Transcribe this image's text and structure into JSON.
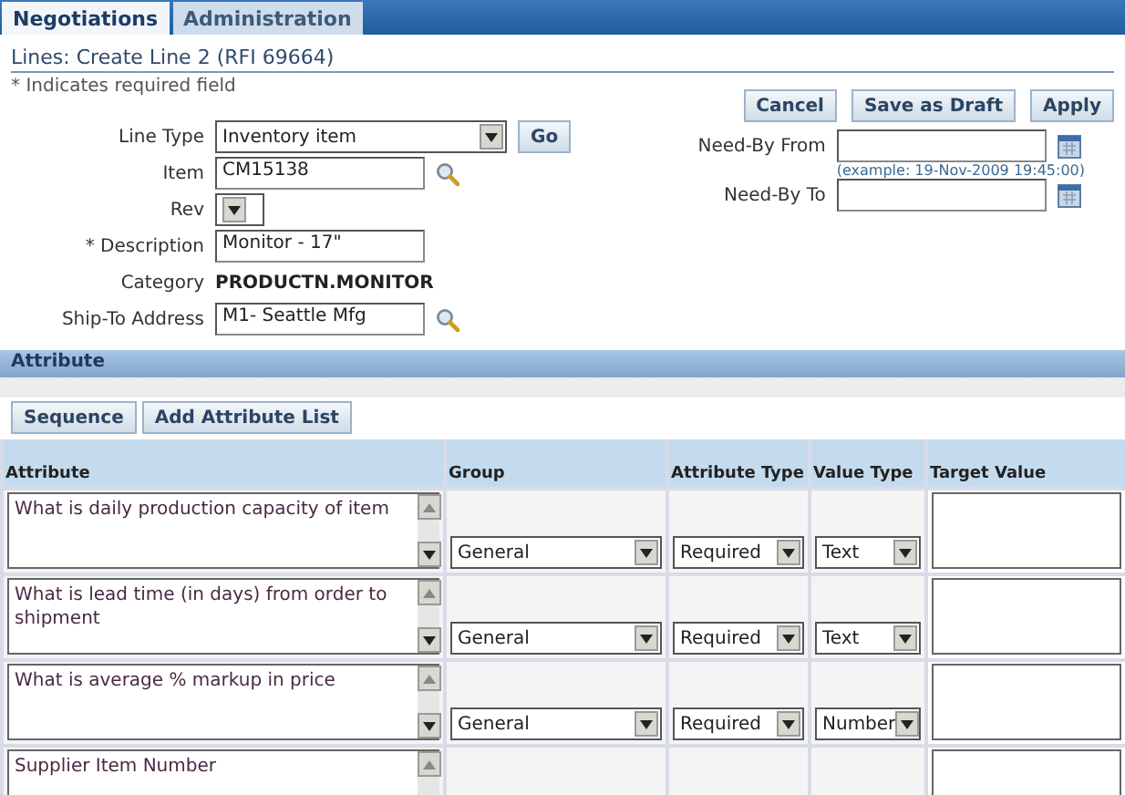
{
  "tabs": [
    {
      "label": "Negotiations",
      "selected": true
    },
    {
      "label": "Administration",
      "selected": false
    }
  ],
  "page_title": "Lines: Create Line 2 (RFI 69664)",
  "required_note": {
    "mark": "*",
    "text": "Indicates required field"
  },
  "actions": [
    "Cancel",
    "Save as Draft",
    "Apply"
  ],
  "left_fields": [
    {
      "label": "Line Type",
      "required": false,
      "kind": "select",
      "value": "Inventory item",
      "action": "Go"
    },
    {
      "label": "Item",
      "required": false,
      "kind": "text",
      "value": "CM15138",
      "lookup": true
    },
    {
      "label": "Rev",
      "required": false,
      "kind": "mini-select"
    },
    {
      "label": "Description",
      "required": true,
      "kind": "text",
      "value": "Monitor - 17\"",
      "lookup": false
    },
    {
      "label": "Category",
      "required": false,
      "kind": "static",
      "value": "PRODUCTN.MONITOR"
    },
    {
      "label": "Ship-To Address",
      "required": false,
      "kind": "text",
      "value": "M1- Seattle Mfg",
      "lookup": true
    }
  ],
  "right_fields": [
    {
      "label": "Need-By From",
      "hint": "(example: 19-Nov-2009 19:45:00)"
    },
    {
      "label": "Need-By To"
    }
  ],
  "attribute_section": {
    "title": "Attribute",
    "buttons": [
      "Sequence",
      "Add Attribute List"
    ],
    "columns": [
      "Attribute",
      "Group",
      "Attribute Type",
      "Value Type",
      "Target Value"
    ],
    "rows": [
      {
        "attribute": "What is daily production capacity of item",
        "group": "General",
        "attribute_type": "Required",
        "value_type": "Text"
      },
      {
        "attribute": "What is lead time (in days) from order to shipment",
        "group": "General",
        "attribute_type": "Required",
        "value_type": "Text"
      },
      {
        "attribute": "What is average % markup in price",
        "group": "General",
        "attribute_type": "Required",
        "value_type": "Number"
      },
      {
        "attribute": "Supplier Item Number"
      }
    ]
  }
}
